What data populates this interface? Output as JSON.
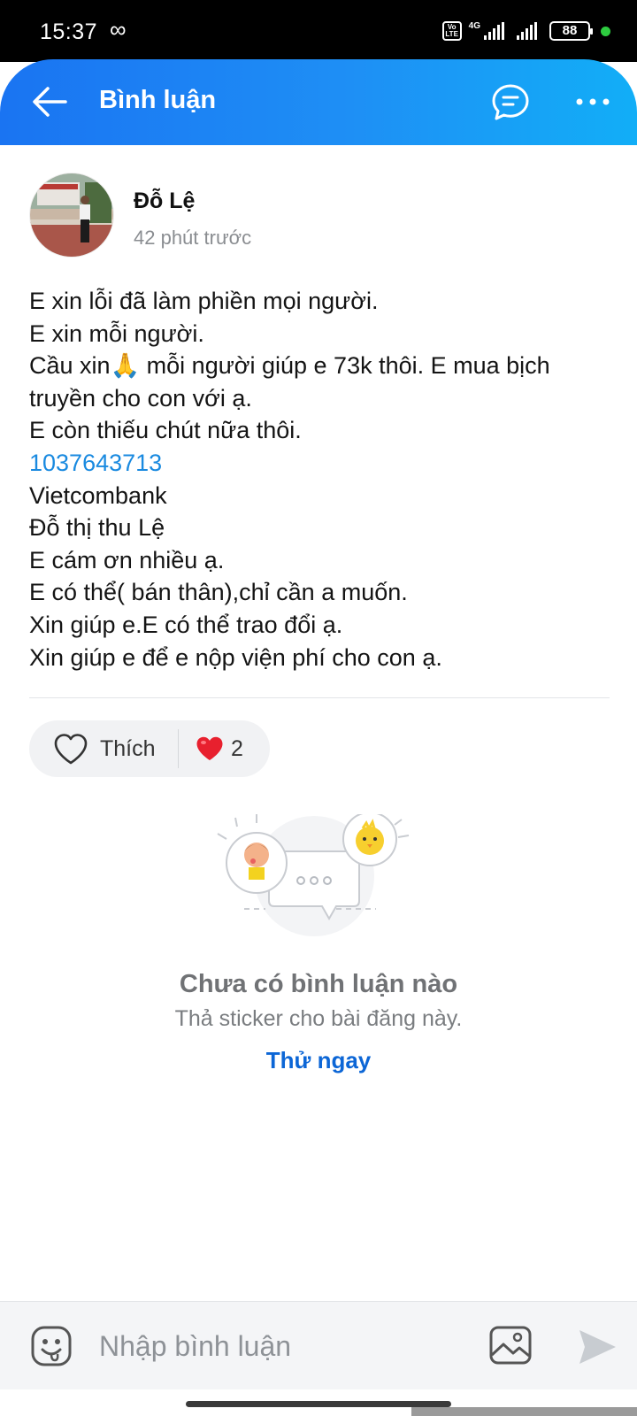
{
  "status_bar": {
    "time": "15:37",
    "infinity": "∞",
    "network": "4G",
    "volte": "Vo LTE",
    "battery": "88"
  },
  "header": {
    "title": "Bình luận",
    "back_icon": "arrow-left-icon",
    "chat_icon": "chat-bubble-icon",
    "more_icon": "more-horizontal-icon"
  },
  "post": {
    "author": "Đỗ Lệ",
    "time_ago": "42 phút trước",
    "lines": [
      "E xin lỗi đã làm phiền mọi người.",
      "E xin mỗi người.",
      "Cầu xin🙏 mỗi người giúp e 73k thôi. E mua bịch",
      "truyền cho con với ạ.",
      "E còn thiếu chút nữa thôi."
    ],
    "account_number": "1037643713",
    "lines_after": [
      "Vietcombank",
      "Đỗ thị thu Lệ",
      "E cám ơn nhiều ạ.",
      "E có thể( bán thân),chỉ cần a muốn.",
      "Xin giúp e.E có thể trao đổi ạ.",
      "Xin giúp e để e nộp viện phí cho con ạ."
    ]
  },
  "reactions": {
    "like_label": "Thích",
    "count": "2",
    "like_icon": "heart-outline-icon",
    "reaction_icon": "red-heart-icon"
  },
  "empty_state": {
    "title": "Chưa có bình luận nào",
    "subtitle": "Thả sticker cho bài đăng này.",
    "action": "Thử ngay"
  },
  "composer": {
    "placeholder": "Nhập bình luận",
    "emoji_icon": "emoji-smile-icon",
    "image_icon": "image-icon",
    "send_icon": "send-icon"
  },
  "colors": {
    "header_start": "#1a74f2",
    "header_end": "#12aef7",
    "link": "#1a8ae0",
    "action": "#0c66d6",
    "heart": "#e8202e"
  }
}
